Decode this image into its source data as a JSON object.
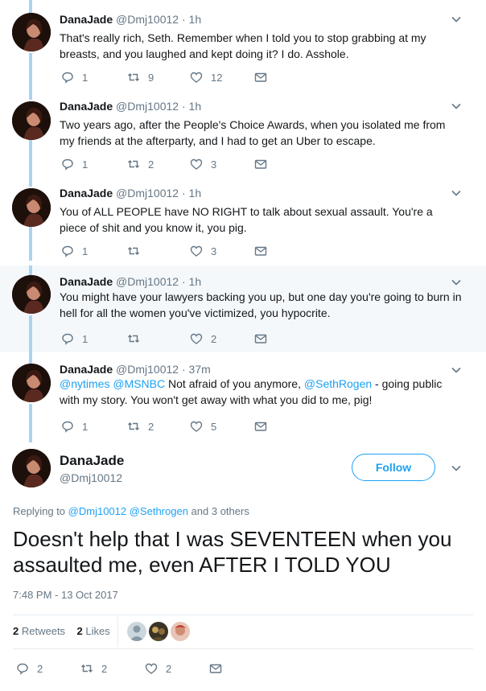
{
  "colors": {
    "accent": "#1da1f2",
    "muted": "#657786",
    "thread": "#a8d4f2",
    "highlight_bg": "#f5f8fa"
  },
  "thread": [
    {
      "name": "DanaJade",
      "handle": "@Dmj10012",
      "sep": "·",
      "time": "1h",
      "text": "That's really rich, Seth. Remember when I told you to stop grabbing at my breasts, and you laughed and kept doing it? I do. Asshole.",
      "replies": "1",
      "retweets": "9",
      "likes": "12"
    },
    {
      "name": "DanaJade",
      "handle": "@Dmj10012",
      "sep": "·",
      "time": "1h",
      "text": "Two years ago, after the People's Choice Awards, when you isolated me from my friends at the afterparty, and I had to get an Uber to escape.",
      "replies": "1",
      "retweets": "2",
      "likes": "3"
    },
    {
      "name": "DanaJade",
      "handle": "@Dmj10012",
      "sep": "·",
      "time": "1h",
      "text": "You of ALL PEOPLE have NO RIGHT to talk about sexual assault. You're a piece of shit and you know it, you pig.",
      "replies": "1",
      "retweets": "",
      "likes": "3"
    },
    {
      "name": "DanaJade",
      "handle": "@Dmj10012",
      "sep": "·",
      "time": "1h",
      "text": "You might have your lawyers backing you up, but one day you're going to burn in hell for all the women you've victimized, you hypocrite.",
      "replies": "1",
      "retweets": "",
      "likes": "2"
    },
    {
      "name": "DanaJade",
      "handle": "@Dmj10012",
      "sep": "·",
      "time": "37m",
      "mention1": "@nytimes",
      "mention2": "@MSNBC",
      "text_a": " Not afraid of you anymore, ",
      "mention3": "@SethRogen",
      "text_b": " - going public with my story. You won't get away with what you did to me, pig!",
      "replies": "1",
      "retweets": "2",
      "likes": "5"
    }
  ],
  "main_tweet": {
    "name": "DanaJade",
    "handle": "@Dmj10012",
    "follow_label": "Follow",
    "replying_prefix": "Replying to ",
    "replying_to_1": "@Dmj10012",
    "replying_to_2": "@Sethrogen",
    "replying_suffix": " and 3 others",
    "text": "Doesn't help that I was SEVENTEEN when you assaulted me, even AFTER I TOLD YOU",
    "timestamp": "7:48 PM - 13 Oct 2017",
    "retweets_count": "2",
    "retweets_label": "Retweets",
    "likes_count": "2",
    "likes_label": "Likes",
    "replies": "2",
    "retweets": "2",
    "likes": "2"
  },
  "icons": {
    "reply": "reply-icon",
    "retweet": "retweet-icon",
    "like": "heart-icon",
    "dm": "envelope-icon",
    "more": "chevron-down-icon"
  }
}
